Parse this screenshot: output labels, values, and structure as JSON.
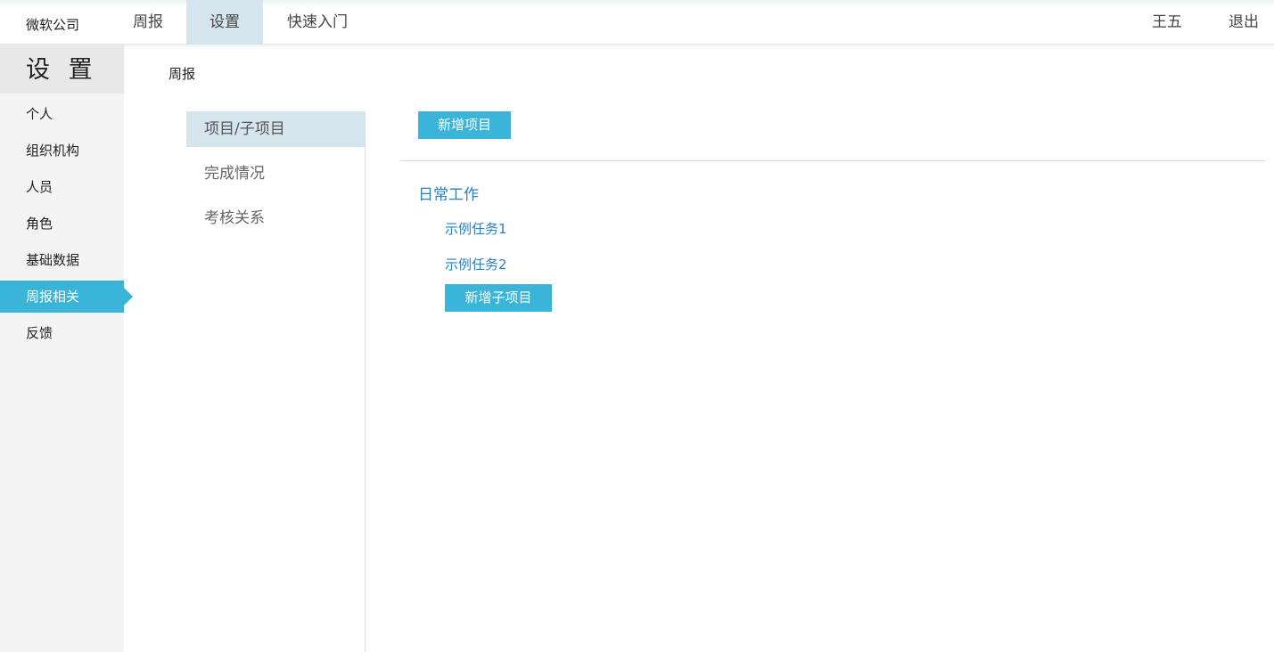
{
  "header": {
    "company": "微软公司",
    "nav": [
      {
        "label": "周报"
      },
      {
        "label": "设置"
      },
      {
        "label": "快速入门"
      }
    ],
    "user": "王五",
    "logout": "退出"
  },
  "sidebar": {
    "title": "设 置",
    "items": [
      {
        "label": "个人"
      },
      {
        "label": "组织机构"
      },
      {
        "label": "人员"
      },
      {
        "label": "角色"
      },
      {
        "label": "基础数据"
      },
      {
        "label": "周报相关"
      },
      {
        "label": "反馈"
      }
    ],
    "active_item": "周报相关"
  },
  "breadcrumb": "周报",
  "subnav": {
    "items": [
      {
        "label": "项目/子项目"
      },
      {
        "label": "完成情况"
      },
      {
        "label": "考核关系"
      }
    ],
    "active_item": "项目/子项目"
  },
  "main": {
    "add_project_label": "新增项目",
    "projects": [
      {
        "name": "日常工作",
        "tasks": [
          {
            "name": "示例任务1"
          },
          {
            "name": "示例任务2"
          }
        ],
        "add_subproject_label": "新增子项目"
      }
    ]
  },
  "colors": {
    "accent": "#3bb4d9",
    "link": "#2a7fc4",
    "active_tab_bg": "#d5e5ed"
  }
}
